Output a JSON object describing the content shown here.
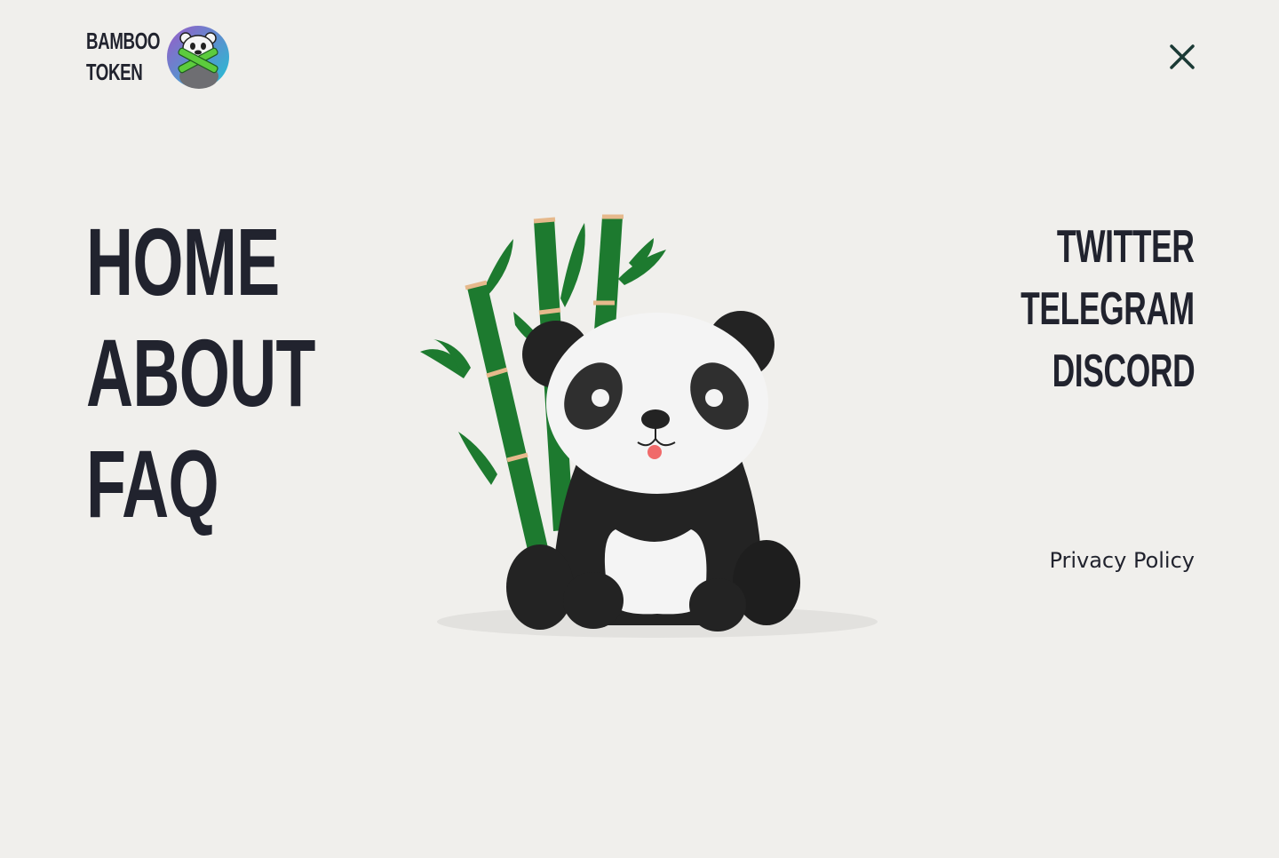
{
  "brand": {
    "line1": "BAMBOO",
    "line2": "TOKEN",
    "logo_icon": "panda-bamboo-logo-icon"
  },
  "header": {
    "close_icon": "close-icon"
  },
  "nav": {
    "main": [
      {
        "label": "HOME"
      },
      {
        "label": "ABOUT"
      },
      {
        "label": "FAQ"
      }
    ],
    "social": [
      {
        "label": "TWITTER"
      },
      {
        "label": "TELEGRAM"
      },
      {
        "label": "DISCORD"
      }
    ]
  },
  "footer": {
    "privacy_label": "Privacy Policy"
  },
  "colors": {
    "background": "#f0efec",
    "text": "#21232e",
    "close": "#1b3a35",
    "bamboo": "#1d7a2f",
    "bamboo_ring": "#e6b98c",
    "panda_black": "#232323",
    "panda_white": "#f4f4f4"
  }
}
